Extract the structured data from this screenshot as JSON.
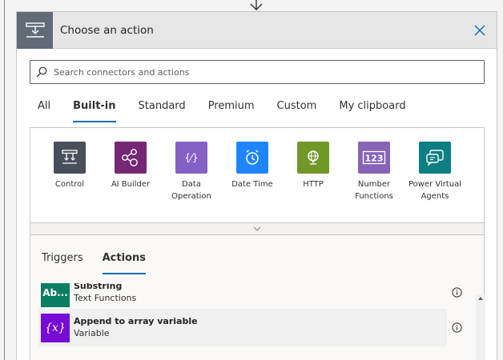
{
  "header": {
    "title": "Choose an action",
    "icon": "step-icon",
    "close_icon": "close-icon"
  },
  "search": {
    "placeholder": "Search connectors and actions",
    "value": ""
  },
  "tabs": [
    {
      "label": "All",
      "active": false
    },
    {
      "label": "Built-in",
      "active": true
    },
    {
      "label": "Standard",
      "active": false
    },
    {
      "label": "Premium",
      "active": false
    },
    {
      "label": "Custom",
      "active": false
    },
    {
      "label": "My clipboard",
      "active": false
    }
  ],
  "connectors": [
    {
      "label": "Control",
      "color": "#484f58",
      "icon": "control-icon"
    },
    {
      "label": "AI Builder",
      "color": "#742774",
      "icon": "ai-builder-icon"
    },
    {
      "label": "Data Operation",
      "color": "#8661c5",
      "icon": "data-operation-icon"
    },
    {
      "label": "Date Time",
      "color": "#1f85ff",
      "icon": "clock-icon"
    },
    {
      "label": "HTTP",
      "color": "#709727",
      "icon": "globe-icon"
    },
    {
      "label": "Number Functions",
      "color": "#8764b8",
      "icon": "number-123-icon"
    },
    {
      "label": "Power Virtual Agents",
      "color": "#0b7f82",
      "icon": "chat-bot-icon"
    }
  ],
  "lower_tabs": [
    {
      "label": "Triggers",
      "active": false
    },
    {
      "label": "Actions",
      "active": true
    }
  ],
  "actions": [
    {
      "title": "Substring",
      "subtitle": "Text Functions",
      "color": "#0b7d60",
      "icon_text": "Ab..."
    },
    {
      "title": "Append to array variable",
      "subtitle": "Variable",
      "color": "#770bd6",
      "icon_text": "{x}"
    }
  ]
}
